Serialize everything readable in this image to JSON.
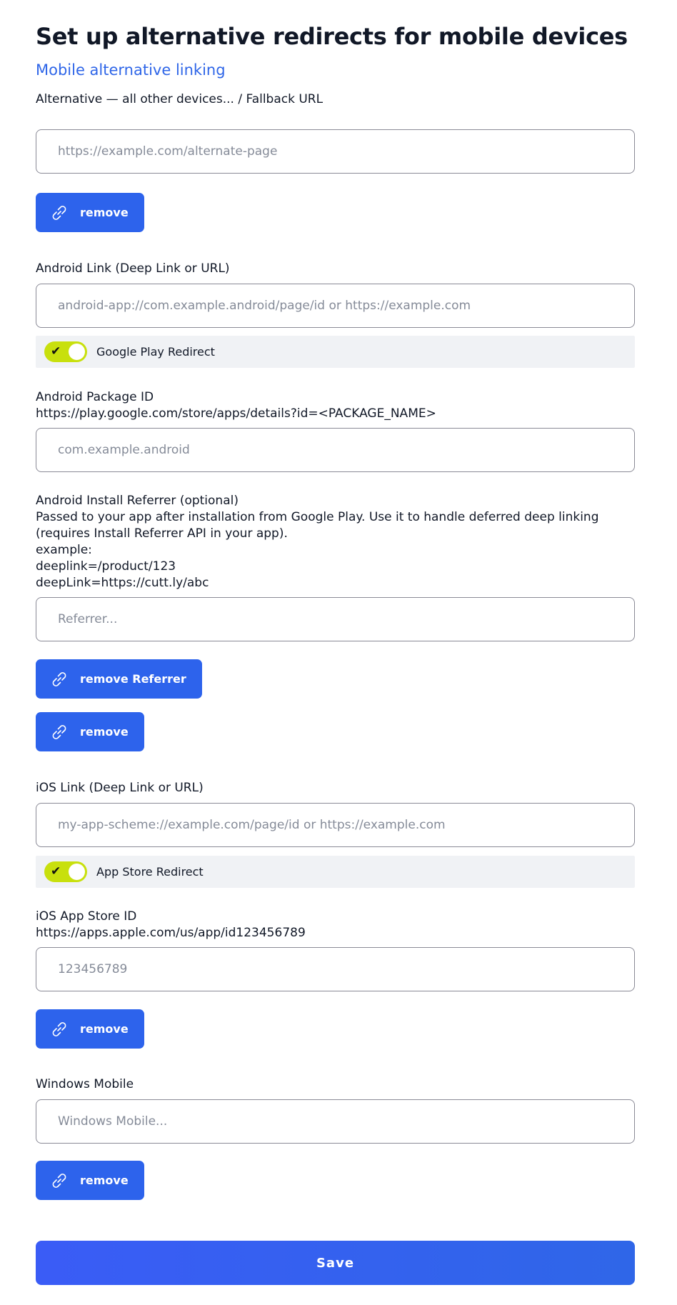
{
  "header": {
    "title": "Set up alternative redirects for mobile devices",
    "subtitle": "Mobile alternative linking"
  },
  "fallback": {
    "label": "Alternative — all other devices... / Fallback URL",
    "placeholder": "https://example.com/alternate-page",
    "value": "",
    "remove_label": "remove"
  },
  "android": {
    "link_label": "Android Link (Deep Link or URL)",
    "link_placeholder": "android-app://com.example.android/page/id or https://example.com",
    "link_value": "",
    "redirect_toggle_label": "Google Play Redirect",
    "redirect_enabled": true,
    "package_label_line1": "Android Package ID",
    "package_label_line2": "https://play.google.com/store/apps/details?id=<PACKAGE_NAME>",
    "package_placeholder": "com.example.android",
    "package_value": "",
    "referrer_label_line1": "Android Install Referrer (optional)",
    "referrer_label_line2": "Passed to your app after installation from Google Play. Use it to handle deferred deep linking",
    "referrer_label_line3": "(requires Install Referrer API in your app).",
    "referrer_label_line4": "example:",
    "referrer_label_line5": "deeplink=/product/123",
    "referrer_label_line6": "deepLink=https://cutt.ly/abc",
    "referrer_placeholder": "Referrer...",
    "referrer_value": "",
    "remove_referrer_label": "remove Referrer",
    "remove_label": "remove"
  },
  "ios": {
    "link_label": "iOS Link (Deep Link or URL)",
    "link_placeholder": "my-app-scheme://example.com/page/id or https://example.com",
    "link_value": "",
    "redirect_toggle_label": "App Store Redirect",
    "redirect_enabled": true,
    "store_label_line1": "iOS App Store ID",
    "store_label_line2": "https://apps.apple.com/us/app/id123456789",
    "store_placeholder": "123456789",
    "store_value": "",
    "remove_label": "remove"
  },
  "windows": {
    "label": "Windows Mobile",
    "placeholder": "Windows Mobile...",
    "value": "",
    "remove_label": "remove"
  },
  "footer": {
    "save_label": "Save"
  },
  "icons": {
    "remove_button_icon": "link-icon",
    "toggle_icon": "check-icon"
  },
  "colors": {
    "accent": "#2d63ec",
    "subtitle": "#2f66e8",
    "toggle_on": "#c8e00d",
    "toggle_row_bg": "#f0f2f5"
  }
}
